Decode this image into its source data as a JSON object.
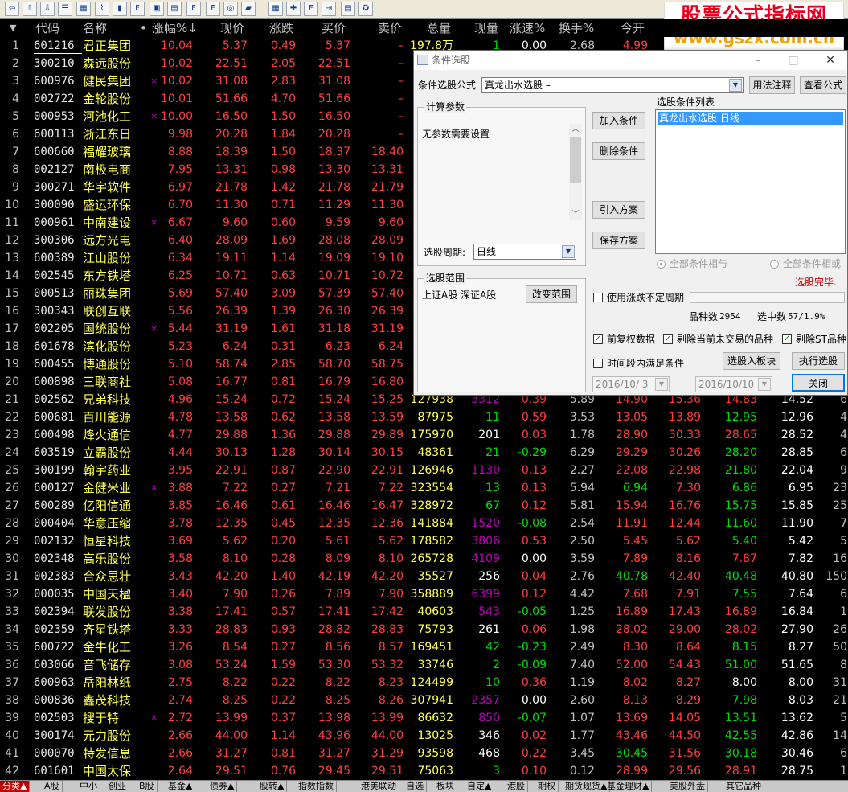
{
  "toolbar": {
    "icons": [
      "back-arrow-icon",
      "up-arrow-icon",
      "down-arrow-icon",
      "list-icon",
      "grid-icon",
      "line-chart-icon",
      "kline-icon",
      "f10-icon",
      "fig-icon",
      "doc-icon",
      "f12-icon",
      "f10b-icon",
      "circle-icon",
      "folder-icon",
      "table-icon",
      "expand-icon",
      "etf-icon",
      "export-icon",
      "print-icon",
      "settings-icon"
    ],
    "glyphs": [
      "⇦",
      "⇧",
      "⇩",
      "☰",
      "▦",
      "⌇",
      "▮",
      "F",
      "▣",
      "▤",
      "F",
      "F",
      "◎",
      "▰",
      "▦",
      "✚",
      "E",
      "⇥",
      "▤",
      "✪"
    ]
  },
  "watermark": {
    "line1": "股票公式指标网",
    "line2": "www.gszx.com.cn"
  },
  "header": {
    "sort_marker": "▼",
    "cols": [
      "代码",
      "名称",
      "•",
      "涨幅%↓",
      "现价",
      "涨跌",
      "买价",
      "卖价",
      "总量",
      "现量",
      "涨速%",
      "换手%",
      "今开"
    ]
  },
  "rows": [
    {
      "i": "1",
      "code": "601216",
      "name": "君正集团",
      "m": "",
      "zf": "10.04",
      "xj": "5.37",
      "zd": "0.49",
      "mj": "5.37",
      "sj": "–",
      "zl": "197.8万",
      "xl": "1",
      "zs": "0.00",
      "hs": "2.68",
      "jk": "4.99",
      "o1": "",
      "o2": "",
      "o3": "",
      "o4": ""
    },
    {
      "i": "2",
      "code": "300210",
      "name": "森远股份",
      "m": "",
      "zf": "10.02",
      "xj": "22.51",
      "zd": "2.05",
      "mj": "22.51",
      "sj": "–",
      "zl": "",
      "xl": "",
      "zs": "",
      "hs": "",
      "jk": "",
      "o1": "",
      "o2": "",
      "o3": "",
      "o4": ""
    },
    {
      "i": "3",
      "code": "600976",
      "name": "健民集团",
      "m": "×",
      "zf": "10.02",
      "xj": "31.08",
      "zd": "2.83",
      "mj": "31.08",
      "sj": "–",
      "zl": "",
      "xl": "",
      "zs": "",
      "hs": "",
      "jk": "",
      "o1": "",
      "o2": "",
      "o3": "",
      "o4": ""
    },
    {
      "i": "4",
      "code": "002722",
      "name": "金轮股份",
      "m": "",
      "zf": "10.01",
      "xj": "51.66",
      "zd": "4.70",
      "mj": "51.66",
      "sj": "–",
      "zl": "",
      "xl": "",
      "zs": "",
      "hs": "",
      "jk": "",
      "o1": "",
      "o2": "",
      "o3": "",
      "o4": ""
    },
    {
      "i": "5",
      "code": "000953",
      "name": "河池化工",
      "m": "×",
      "zf": "10.00",
      "xj": "16.50",
      "zd": "1.50",
      "mj": "16.50",
      "sj": "–",
      "zl": "",
      "xl": "",
      "zs": "",
      "hs": "",
      "jk": "",
      "o1": "",
      "o2": "",
      "o3": "",
      "o4": ""
    },
    {
      "i": "6",
      "code": "600113",
      "name": "浙江东日",
      "m": "",
      "zf": "9.98",
      "xj": "20.28",
      "zd": "1.84",
      "mj": "20.28",
      "sj": "–",
      "zl": "",
      "xl": "",
      "zs": "",
      "hs": "",
      "jk": "",
      "o1": "",
      "o2": "",
      "o3": "",
      "o4": ""
    },
    {
      "i": "7",
      "code": "600660",
      "name": "福耀玻璃",
      "m": "",
      "zf": "8.88",
      "xj": "18.39",
      "zd": "1.50",
      "mj": "18.37",
      "sj": "18.40",
      "zl": "",
      "xl": "",
      "zs": "",
      "hs": "",
      "jk": "",
      "o1": "",
      "o2": "",
      "o3": "",
      "o4": ""
    },
    {
      "i": "8",
      "code": "002127",
      "name": "南极电商",
      "m": "",
      "zf": "7.95",
      "xj": "13.31",
      "zd": "0.98",
      "mj": "13.30",
      "sj": "13.31",
      "zl": "",
      "xl": "",
      "zs": "",
      "hs": "",
      "jk": "",
      "o1": "",
      "o2": "",
      "o3": "",
      "o4": ""
    },
    {
      "i": "9",
      "code": "300271",
      "name": "华宇软件",
      "m": "",
      "zf": "6.97",
      "xj": "21.78",
      "zd": "1.42",
      "mj": "21.78",
      "sj": "21.79",
      "zl": "",
      "xl": "",
      "zs": "",
      "hs": "",
      "jk": "",
      "o1": "",
      "o2": "",
      "o3": "",
      "o4": ""
    },
    {
      "i": "10",
      "code": "300090",
      "name": "盛运环保",
      "m": "",
      "zf": "6.70",
      "xj": "11.30",
      "zd": "0.71",
      "mj": "11.29",
      "sj": "11.30",
      "zl": "",
      "xl": "",
      "zs": "",
      "hs": "",
      "jk": "",
      "o1": "",
      "o2": "",
      "o3": "",
      "o4": ""
    },
    {
      "i": "11",
      "code": "000961",
      "name": "中南建设",
      "m": "×",
      "zf": "6.67",
      "xj": "9.60",
      "zd": "0.60",
      "mj": "9.59",
      "sj": "9.60",
      "zl": "",
      "xl": "",
      "zs": "",
      "hs": "",
      "jk": "",
      "o1": "",
      "o2": "",
      "o3": "",
      "o4": ""
    },
    {
      "i": "12",
      "code": "300306",
      "name": "远方光电",
      "m": "",
      "zf": "6.40",
      "xj": "28.09",
      "zd": "1.69",
      "mj": "28.08",
      "sj": "28.09",
      "zl": "",
      "xl": "",
      "zs": "",
      "hs": "",
      "jk": "",
      "o1": "",
      "o2": "",
      "o3": "",
      "o4": ""
    },
    {
      "i": "13",
      "code": "600389",
      "name": "江山股份",
      "m": "",
      "zf": "6.34",
      "xj": "19.11",
      "zd": "1.14",
      "mj": "19.09",
      "sj": "19.10",
      "zl": "",
      "xl": "",
      "zs": "",
      "hs": "",
      "jk": "",
      "o1": "",
      "o2": "",
      "o3": "",
      "o4": ""
    },
    {
      "i": "14",
      "code": "002545",
      "name": "东方铁塔",
      "m": "",
      "zf": "6.25",
      "xj": "10.71",
      "zd": "0.63",
      "mj": "10.71",
      "sj": "10.72",
      "zl": "",
      "xl": "",
      "zs": "",
      "hs": "",
      "jk": "",
      "o1": "",
      "o2": "",
      "o3": "",
      "o4": ""
    },
    {
      "i": "15",
      "code": "000513",
      "name": "丽珠集团",
      "m": "",
      "zf": "5.69",
      "xj": "57.40",
      "zd": "3.09",
      "mj": "57.39",
      "sj": "57.40",
      "zl": "",
      "xl": "",
      "zs": "",
      "hs": "",
      "jk": "",
      "o1": "",
      "o2": "",
      "o3": "",
      "o4": ""
    },
    {
      "i": "16",
      "code": "300343",
      "name": "联创互联",
      "m": "",
      "zf": "5.56",
      "xj": "26.39",
      "zd": "1.39",
      "mj": "26.30",
      "sj": "26.39",
      "zl": "",
      "xl": "",
      "zs": "",
      "hs": "",
      "jk": "",
      "o1": "",
      "o2": "",
      "o3": "",
      "o4": ""
    },
    {
      "i": "17",
      "code": "002205",
      "name": "国统股份",
      "m": "×",
      "zf": "5.44",
      "xj": "31.19",
      "zd": "1.61",
      "mj": "31.18",
      "sj": "31.19",
      "zl": "",
      "xl": "",
      "zs": "",
      "hs": "",
      "jk": "",
      "o1": "",
      "o2": "",
      "o3": "",
      "o4": ""
    },
    {
      "i": "18",
      "code": "601678",
      "name": "滨化股份",
      "m": "",
      "zf": "5.23",
      "xj": "6.24",
      "zd": "0.31",
      "mj": "6.23",
      "sj": "6.24",
      "zl": "",
      "xl": "",
      "zs": "",
      "hs": "",
      "jk": "",
      "o1": "",
      "o2": "",
      "o3": "",
      "o4": ""
    },
    {
      "i": "19",
      "code": "600455",
      "name": "博通股份",
      "m": "",
      "zf": "5.10",
      "xj": "58.74",
      "zd": "2.85",
      "mj": "58.70",
      "sj": "58.75",
      "zl": "",
      "xl": "",
      "zs": "",
      "hs": "",
      "jk": "",
      "o1": "",
      "o2": "",
      "o3": "",
      "o4": ""
    },
    {
      "i": "20",
      "code": "600898",
      "name": "三联商社",
      "m": "",
      "zf": "5.08",
      "xj": "16.77",
      "zd": "0.81",
      "mj": "16.79",
      "sj": "16.80",
      "zl": "",
      "xl": "",
      "zs": "",
      "hs": "",
      "jk": "",
      "o1": "",
      "o2": "",
      "o3": "",
      "o4": ""
    },
    {
      "i": "21",
      "code": "002562",
      "name": "兄弟科技",
      "m": "",
      "zf": "4.96",
      "xj": "15.24",
      "zd": "0.72",
      "mj": "15.24",
      "sj": "15.25",
      "zl": "127938",
      "xl": "3312",
      "zs": "0.39",
      "hs": "5.89",
      "jk": "14.90",
      "o1": "15.36",
      "o2": "14.83",
      "o3": "14.52",
      "o4": "6"
    },
    {
      "i": "22",
      "code": "600681",
      "name": "百川能源",
      "m": "",
      "zf": "4.78",
      "xj": "13.58",
      "zd": "0.62",
      "mj": "13.58",
      "sj": "13.59",
      "zl": "87975",
      "xl": "11",
      "zs": "0.59",
      "hs": "3.53",
      "jk": "13.05",
      "o1": "13.89",
      "o2": "12.95",
      "o3": "12.96",
      "o4": "4"
    },
    {
      "i": "23",
      "code": "600498",
      "name": "烽火通信",
      "m": "",
      "zf": "4.77",
      "xj": "29.88",
      "zd": "1.36",
      "mj": "29.88",
      "sj": "29.89",
      "zl": "175970",
      "xl": "201",
      "zs": "0.03",
      "hs": "1.78",
      "jk": "28.90",
      "o1": "30.33",
      "o2": "28.65",
      "o3": "28.52",
      "o4": "4"
    },
    {
      "i": "24",
      "code": "603519",
      "name": "立霸股份",
      "m": "",
      "zf": "4.44",
      "xj": "30.13",
      "zd": "1.28",
      "mj": "30.14",
      "sj": "30.15",
      "zl": "48361",
      "xl": "21",
      "zs": "-0.29",
      "hs": "6.29",
      "jk": "29.29",
      "o1": "30.26",
      "o2": "28.20",
      "o3": "28.85",
      "o4": "6"
    },
    {
      "i": "25",
      "code": "300199",
      "name": "翰宇药业",
      "m": "",
      "zf": "3.95",
      "xj": "22.91",
      "zd": "0.87",
      "mj": "22.90",
      "sj": "22.91",
      "zl": "126946",
      "xl": "1130",
      "zs": "0.13",
      "hs": "2.27",
      "jk": "22.08",
      "o1": "22.98",
      "o2": "21.80",
      "o3": "22.04",
      "o4": "9"
    },
    {
      "i": "26",
      "code": "600127",
      "name": "金健米业",
      "m": "×",
      "zf": "3.88",
      "xj": "7.22",
      "zd": "0.27",
      "mj": "7.21",
      "sj": "7.22",
      "zl": "323554",
      "xl": "13",
      "zs": "0.13",
      "hs": "5.94",
      "jk": "6.94",
      "o1": "7.30",
      "o2": "6.86",
      "o3": "6.95",
      "o4": "23"
    },
    {
      "i": "27",
      "code": "600289",
      "name": "亿阳信通",
      "m": "",
      "zf": "3.85",
      "xj": "16.46",
      "zd": "0.61",
      "mj": "16.46",
      "sj": "16.47",
      "zl": "328972",
      "xl": "67",
      "zs": "0.12",
      "hs": "5.81",
      "jk": "15.94",
      "o1": "16.76",
      "o2": "15.75",
      "o3": "15.85",
      "o4": "25"
    },
    {
      "i": "28",
      "code": "000404",
      "name": "华意压缩",
      "m": "",
      "zf": "3.78",
      "xj": "12.35",
      "zd": "0.45",
      "mj": "12.35",
      "sj": "12.36",
      "zl": "141884",
      "xl": "1520",
      "zs": "-0.08",
      "hs": "2.54",
      "jk": "11.91",
      "o1": "12.44",
      "o2": "11.60",
      "o3": "11.90",
      "o4": "7"
    },
    {
      "i": "29",
      "code": "002132",
      "name": "恒星科技",
      "m": "",
      "zf": "3.69",
      "xj": "5.62",
      "zd": "0.20",
      "mj": "5.61",
      "sj": "5.62",
      "zl": "178582",
      "xl": "3806",
      "zs": "0.53",
      "hs": "2.50",
      "jk": "5.45",
      "o1": "5.62",
      "o2": "5.40",
      "o3": "5.42",
      "o4": "5"
    },
    {
      "i": "30",
      "code": "002348",
      "name": "高乐股份",
      "m": "",
      "zf": "3.58",
      "xj": "8.10",
      "zd": "0.28",
      "mj": "8.09",
      "sj": "8.10",
      "zl": "265728",
      "xl": "4109",
      "zs": "0.00",
      "hs": "3.59",
      "jk": "7.89",
      "o1": "8.16",
      "o2": "7.87",
      "o3": "7.82",
      "o4": "16"
    },
    {
      "i": "31",
      "code": "002383",
      "name": "合众思壮",
      "m": "",
      "zf": "3.43",
      "xj": "42.20",
      "zd": "1.40",
      "mj": "42.19",
      "sj": "42.20",
      "zl": "35527",
      "xl": "256",
      "zs": "0.04",
      "hs": "2.76",
      "jk": "40.78",
      "o1": "42.40",
      "o2": "40.48",
      "o3": "40.80",
      "o4": "150"
    },
    {
      "i": "32",
      "code": "000035",
      "name": "中国天楹",
      "m": "",
      "zf": "3.40",
      "xj": "7.90",
      "zd": "0.26",
      "mj": "7.89",
      "sj": "7.90",
      "zl": "358889",
      "xl": "6399",
      "zs": "0.12",
      "hs": "4.42",
      "jk": "7.68",
      "o1": "7.91",
      "o2": "7.55",
      "o3": "7.64",
      "o4": "6"
    },
    {
      "i": "33",
      "code": "002394",
      "name": "联发股份",
      "m": "",
      "zf": "3.38",
      "xj": "17.41",
      "zd": "0.57",
      "mj": "17.41",
      "sj": "17.42",
      "zl": "40603",
      "xl": "543",
      "zs": "-0.05",
      "hs": "1.25",
      "jk": "16.89",
      "o1": "17.43",
      "o2": "16.89",
      "o3": "16.84",
      "o4": "1"
    },
    {
      "i": "34",
      "code": "002359",
      "name": "齐星铁塔",
      "m": "",
      "zf": "3.33",
      "xj": "28.83",
      "zd": "0.93",
      "mj": "28.82",
      "sj": "28.83",
      "zl": "75793",
      "xl": "261",
      "zs": "0.06",
      "hs": "1.98",
      "jk": "28.02",
      "o1": "29.00",
      "o2": "28.02",
      "o3": "27.90",
      "o4": "26"
    },
    {
      "i": "35",
      "code": "600722",
      "name": "金牛化工",
      "m": "",
      "zf": "3.26",
      "xj": "8.54",
      "zd": "0.27",
      "mj": "8.56",
      "sj": "8.57",
      "zl": "169451",
      "xl": "42",
      "zs": "-0.23",
      "hs": "2.49",
      "jk": "8.30",
      "o1": "8.64",
      "o2": "8.15",
      "o3": "8.27",
      "o4": "50"
    },
    {
      "i": "36",
      "code": "603066",
      "name": "音飞储存",
      "m": "",
      "zf": "3.08",
      "xj": "53.24",
      "zd": "1.59",
      "mj": "53.30",
      "sj": "53.32",
      "zl": "33746",
      "xl": "2",
      "zs": "-0.09",
      "hs": "7.40",
      "jk": "52.00",
      "o1": "54.43",
      "o2": "51.00",
      "o3": "51.65",
      "o4": "8"
    },
    {
      "i": "37",
      "code": "600963",
      "name": "岳阳林纸",
      "m": "",
      "zf": "2.75",
      "xj": "8.22",
      "zd": "0.22",
      "mj": "8.22",
      "sj": "8.23",
      "zl": "124499",
      "xl": "10",
      "zs": "0.36",
      "hs": "1.19",
      "jk": "8.02",
      "o1": "8.27",
      "o2": "8.00",
      "o3": "8.00",
      "o4": "31"
    },
    {
      "i": "38",
      "code": "000836",
      "name": "鑫茂科技",
      "m": "",
      "zf": "2.74",
      "xj": "8.25",
      "zd": "0.22",
      "mj": "8.25",
      "sj": "8.26",
      "zl": "307941",
      "xl": "2357",
      "zs": "0.00",
      "hs": "2.60",
      "jk": "8.13",
      "o1": "8.29",
      "o2": "7.98",
      "o3": "8.03",
      "o4": "21"
    },
    {
      "i": "39",
      "code": "002503",
      "name": "搜于特",
      "m": "×",
      "zf": "2.72",
      "xj": "13.99",
      "zd": "0.37",
      "mj": "13.98",
      "sj": "13.99",
      "zl": "86632",
      "xl": "850",
      "zs": "-0.07",
      "hs": "1.07",
      "jk": "13.69",
      "o1": "14.05",
      "o2": "13.51",
      "o3": "13.62",
      "o4": "5"
    },
    {
      "i": "40",
      "code": "300174",
      "name": "元力股份",
      "m": "",
      "zf": "2.66",
      "xj": "44.00",
      "zd": "1.14",
      "mj": "43.96",
      "sj": "44.00",
      "zl": "13025",
      "xl": "346",
      "zs": "0.02",
      "hs": "1.77",
      "jk": "43.46",
      "o1": "44.50",
      "o2": "42.55",
      "o3": "42.86",
      "o4": "14"
    },
    {
      "i": "41",
      "code": "000070",
      "name": "特发信息",
      "m": "",
      "zf": "2.66",
      "xj": "31.27",
      "zd": "0.81",
      "mj": "31.27",
      "sj": "31.29",
      "zl": "93598",
      "xl": "468",
      "zs": "0.22",
      "hs": "3.45",
      "jk": "30.45",
      "o1": "31.56",
      "o2": "30.18",
      "o3": "30.46",
      "o4": "6"
    },
    {
      "i": "42",
      "code": "601601",
      "name": "中国太保",
      "m": "",
      "zf": "2.64",
      "xj": "29.51",
      "zd": "0.76",
      "mj": "29.45",
      "sj": "29.51",
      "zl": "75063",
      "xl": "3",
      "zs": "0.10",
      "hs": "0.12",
      "jk": "28.99",
      "o1": "29.56",
      "o2": "28.91",
      "o3": "28.75",
      "o4": "1"
    }
  ],
  "tabs": [
    "分类▲",
    "A股",
    "中小",
    "创业",
    "B股",
    "基金▲",
    "债券▲",
    "股转▲",
    "指数指数",
    "港美联动",
    "自选",
    "板块",
    "自定▲",
    "港股",
    "期权",
    "期货现货▲",
    "基金理财▲",
    "美股外盘",
    "其它品种"
  ],
  "dialog": {
    "title": "条件选股",
    "minimize": "–",
    "maximize": "□",
    "close": "✕",
    "formula_label": "条件选股公式",
    "formula_value": "真龙出水选股 –",
    "usage_button": "用法注释",
    "view_formula_button": "查看公式",
    "params_title": "计算参数",
    "params_text": "无参数需要设置",
    "add_cond_button": "加入条件",
    "del_cond_button": "删除条件",
    "import_button": "引入方案",
    "save_button": "保存方案",
    "list_title": "选股条件列表",
    "list_item": "真龙出水选股  日线",
    "radio_and": "全部条件相与",
    "radio_or": "全部条件相或",
    "period_label": "选股周期:",
    "period_value": "日线",
    "range_title": "选股范围",
    "range_text": "上证A股 深证A股",
    "change_range_button": "改变范围",
    "done_text": "选股完毕.",
    "use_period_label": "使用涨跌不定周期",
    "count_label": "品种数",
    "count_value": "2954",
    "selected_label": "选中数",
    "selected_value": "57/1.9%",
    "prev_rights_label": "前复权数据",
    "exclude_suspend_label": "剔除当前未交易的品种",
    "exclude_st_label": "剔除ST品种",
    "time_range_label": "时间段内满足条件",
    "add_to_block_button": "选股入板块",
    "execute_button": "执行选股",
    "date_from": "2016/10/ 3",
    "date_sep": "–",
    "date_to": "2016/10/10",
    "close_button": "关闭",
    "check_prev_rights": true,
    "check_exclude_suspend": true,
    "check_exclude_st": true,
    "check_use_period": false,
    "check_time_range": false,
    "check_mark": "✓"
  },
  "colors": {
    "up": "#ff4040",
    "down": "#00e000",
    "name": "#ffff54",
    "volume": "#ffff54",
    "curvol": "#c000c0"
  }
}
